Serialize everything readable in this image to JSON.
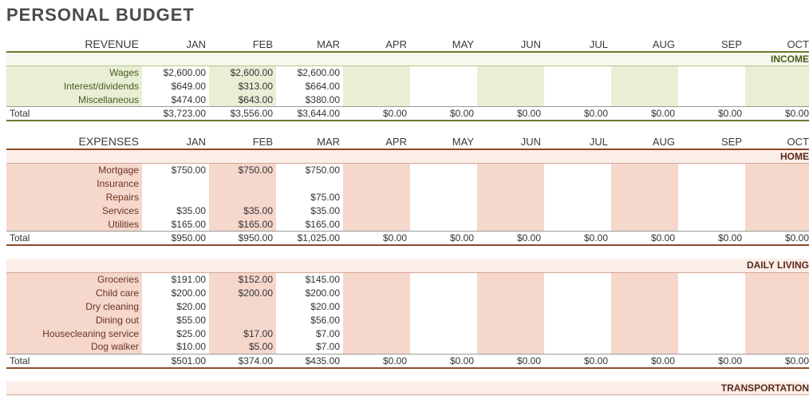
{
  "title": "PERSONAL BUDGET",
  "months": [
    "JAN",
    "FEB",
    "MAR",
    "APR",
    "MAY",
    "JUN",
    "JUL",
    "AUG",
    "SEP",
    "OCT"
  ],
  "revenue_label": "REVENUE",
  "expenses_label": "EXPENSES",
  "total_label": "Total",
  "income": {
    "heading": "INCOME",
    "rows": [
      {
        "label": "Wages",
        "vals": [
          "$2,600.00",
          "$2,600.00",
          "$2,600.00",
          "",
          "",
          "",
          "",
          "",
          "",
          ""
        ]
      },
      {
        "label": "Interest/dividends",
        "vals": [
          "$649.00",
          "$313.00",
          "$664.00",
          "",
          "",
          "",
          "",
          "",
          "",
          ""
        ]
      },
      {
        "label": "Miscellaneous",
        "vals": [
          "$474.00",
          "$643.00",
          "$380.00",
          "",
          "",
          "",
          "",
          "",
          "",
          ""
        ]
      }
    ],
    "total": [
      "$3,723.00",
      "$3,556.00",
      "$3,644.00",
      "$0.00",
      "$0.00",
      "$0.00",
      "$0.00",
      "$0.00",
      "$0.00",
      "$0.00"
    ]
  },
  "home": {
    "heading": "HOME",
    "rows": [
      {
        "label": "Mortgage",
        "vals": [
          "$750.00",
          "$750.00",
          "$750.00",
          "",
          "",
          "",
          "",
          "",
          "",
          ""
        ]
      },
      {
        "label": "Insurance",
        "vals": [
          "",
          "",
          "",
          "",
          "",
          "",
          "",
          "",
          "",
          ""
        ]
      },
      {
        "label": "Repairs",
        "vals": [
          "",
          "",
          "$75.00",
          "",
          "",
          "",
          "",
          "",
          "",
          ""
        ]
      },
      {
        "label": "Services",
        "vals": [
          "$35.00",
          "$35.00",
          "$35.00",
          "",
          "",
          "",
          "",
          "",
          "",
          ""
        ]
      },
      {
        "label": "Utilities",
        "vals": [
          "$165.00",
          "$165.00",
          "$165.00",
          "",
          "",
          "",
          "",
          "",
          "",
          ""
        ]
      }
    ],
    "total": [
      "$950.00",
      "$950.00",
      "$1,025.00",
      "$0.00",
      "$0.00",
      "$0.00",
      "$0.00",
      "$0.00",
      "$0.00",
      "$0.00"
    ]
  },
  "daily": {
    "heading": "DAILY LIVING",
    "rows": [
      {
        "label": "Groceries",
        "vals": [
          "$191.00",
          "$152.00",
          "$145.00",
          "",
          "",
          "",
          "",
          "",
          "",
          ""
        ]
      },
      {
        "label": "Child care",
        "vals": [
          "$200.00",
          "$200.00",
          "$200.00",
          "",
          "",
          "",
          "",
          "",
          "",
          ""
        ]
      },
      {
        "label": "Dry cleaning",
        "vals": [
          "$20.00",
          "",
          "$20.00",
          "",
          "",
          "",
          "",
          "",
          "",
          ""
        ]
      },
      {
        "label": "Dining out",
        "vals": [
          "$55.00",
          "",
          "$56.00",
          "",
          "",
          "",
          "",
          "",
          "",
          ""
        ]
      },
      {
        "label": "Housecleaning service",
        "vals": [
          "$25.00",
          "$17.00",
          "$7.00",
          "",
          "",
          "",
          "",
          "",
          "",
          ""
        ]
      },
      {
        "label": "Dog walker",
        "vals": [
          "$10.00",
          "$5.00",
          "$7.00",
          "",
          "",
          "",
          "",
          "",
          "",
          ""
        ]
      }
    ],
    "total": [
      "$501.00",
      "$374.00",
      "$435.00",
      "$0.00",
      "$0.00",
      "$0.00",
      "$0.00",
      "$0.00",
      "$0.00",
      "$0.00"
    ]
  },
  "transport": {
    "heading": "TRANSPORTATION"
  },
  "chart_data": {
    "type": "table",
    "title": "Personal Budget — Revenue and Expenses by Month",
    "months": [
      "JAN",
      "FEB",
      "MAR",
      "APR",
      "MAY",
      "JUN",
      "JUL",
      "AUG",
      "SEP",
      "OCT"
    ],
    "income": {
      "Wages": [
        2600,
        2600,
        2600,
        null,
        null,
        null,
        null,
        null,
        null,
        null
      ],
      "Interest/dividends": [
        649,
        313,
        664,
        null,
        null,
        null,
        null,
        null,
        null,
        null
      ],
      "Miscellaneous": [
        474,
        643,
        380,
        null,
        null,
        null,
        null,
        null,
        null,
        null
      ],
      "Total": [
        3723,
        3556,
        3644,
        0,
        0,
        0,
        0,
        0,
        0,
        0
      ]
    },
    "expenses": {
      "HOME": {
        "Mortgage": [
          750,
          750,
          750,
          null,
          null,
          null,
          null,
          null,
          null,
          null
        ],
        "Insurance": [
          null,
          null,
          null,
          null,
          null,
          null,
          null,
          null,
          null,
          null
        ],
        "Repairs": [
          null,
          null,
          75,
          null,
          null,
          null,
          null,
          null,
          null,
          null
        ],
        "Services": [
          35,
          35,
          35,
          null,
          null,
          null,
          null,
          null,
          null,
          null
        ],
        "Utilities": [
          165,
          165,
          165,
          null,
          null,
          null,
          null,
          null,
          null,
          null
        ],
        "Total": [
          950,
          950,
          1025,
          0,
          0,
          0,
          0,
          0,
          0,
          0
        ]
      },
      "DAILY LIVING": {
        "Groceries": [
          191,
          152,
          145,
          null,
          null,
          null,
          null,
          null,
          null,
          null
        ],
        "Child care": [
          200,
          200,
          200,
          null,
          null,
          null,
          null,
          null,
          null,
          null
        ],
        "Dry cleaning": [
          20,
          null,
          20,
          null,
          null,
          null,
          null,
          null,
          null,
          null
        ],
        "Dining out": [
          55,
          null,
          56,
          null,
          null,
          null,
          null,
          null,
          null,
          null
        ],
        "Housecleaning service": [
          25,
          17,
          7,
          null,
          null,
          null,
          null,
          null,
          null,
          null
        ],
        "Dog walker": [
          10,
          5,
          7,
          null,
          null,
          null,
          null,
          null,
          null,
          null
        ],
        "Total": [
          501,
          374,
          435,
          0,
          0,
          0,
          0,
          0,
          0,
          0
        ]
      }
    }
  }
}
